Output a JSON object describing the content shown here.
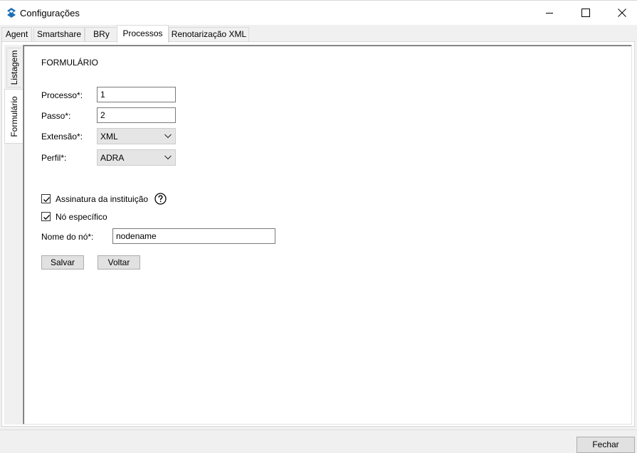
{
  "window": {
    "title": "Configurações",
    "icon": "smartshare-logo-icon",
    "accent_color": "#1e6fb5"
  },
  "tabs": [
    {
      "label": "Agent",
      "active": false
    },
    {
      "label": "Smartshare",
      "active": false
    },
    {
      "label": "BRy",
      "active": false
    },
    {
      "label": "Processos",
      "active": true
    },
    {
      "label": "Renotarização XML",
      "active": false
    }
  ],
  "side_tabs": [
    {
      "label": "Listagem",
      "active": false
    },
    {
      "label": "Formulário",
      "active": true
    }
  ],
  "form": {
    "section_title": "FORMULÁRIO",
    "processo_label": "Processo*:",
    "processo_value": "1",
    "passo_label": "Passo*:",
    "passo_value": "2",
    "extensao_label": "Extensão*:",
    "extensao_value": "XML",
    "perfil_label": "Perfil*:",
    "perfil_value": "ADRA",
    "assinatura_label": "Assinatura da instituição",
    "assinatura_checked": true,
    "no_especifico_label": "Nó específico",
    "no_especifico_checked": true,
    "nome_no_label": "Nome do nó*:",
    "nome_no_value": "nodename",
    "salvar_label": "Salvar",
    "voltar_label": "Voltar"
  },
  "footer": {
    "fechar_label": "Fechar"
  }
}
